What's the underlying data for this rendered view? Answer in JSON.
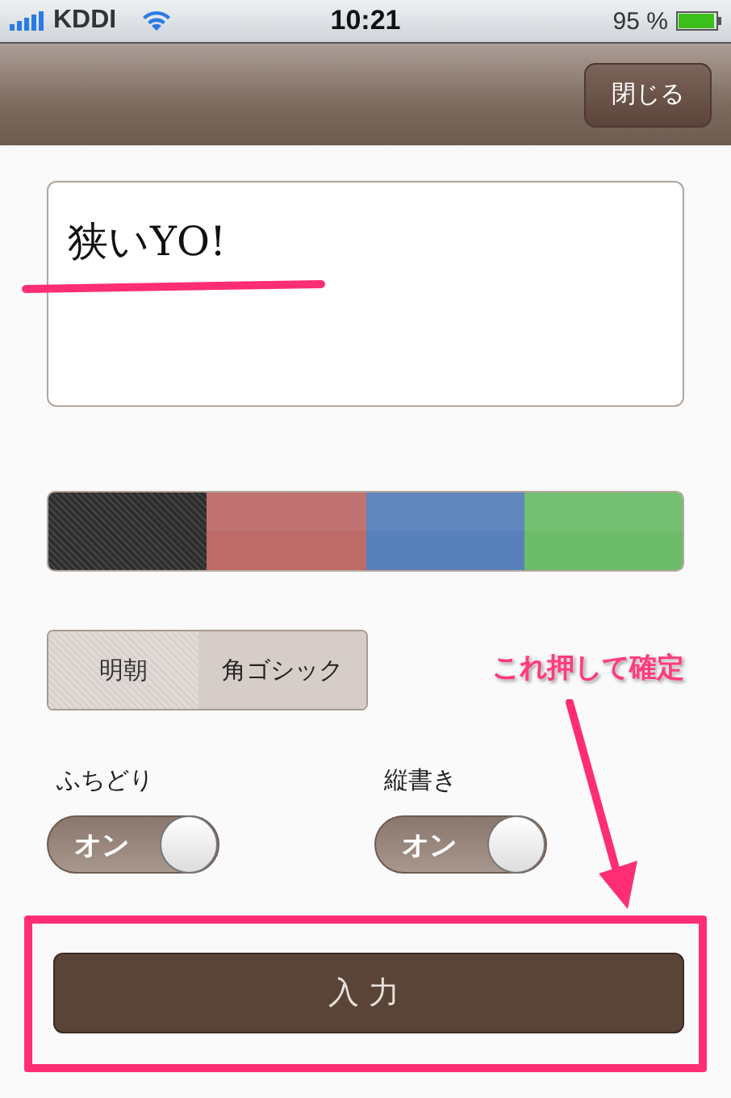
{
  "status_bar": {
    "carrier": "KDDI",
    "time": "10:21",
    "battery": "95 %"
  },
  "nav_bar": {
    "close_button": "閉じる"
  },
  "text_field": {
    "value": "狭いYO!"
  },
  "color_swatches": [
    {
      "color": "#2e2e2e",
      "selected": true
    },
    {
      "color": "#bd6a68",
      "selected": false
    },
    {
      "color": "#5780bb",
      "selected": false
    },
    {
      "color": "#6cbc69",
      "selected": false
    }
  ],
  "font_segments": [
    {
      "label": "明朝",
      "selected": true
    },
    {
      "label": "角ゴシック",
      "selected": false
    }
  ],
  "toggles": [
    {
      "label": "ふちどり",
      "state_text": "オン",
      "on": true
    },
    {
      "label": "縦書き",
      "state_text": "オン",
      "on": true
    }
  ],
  "submit_button": "入力",
  "annotation": {
    "text": "これ押して確定"
  }
}
